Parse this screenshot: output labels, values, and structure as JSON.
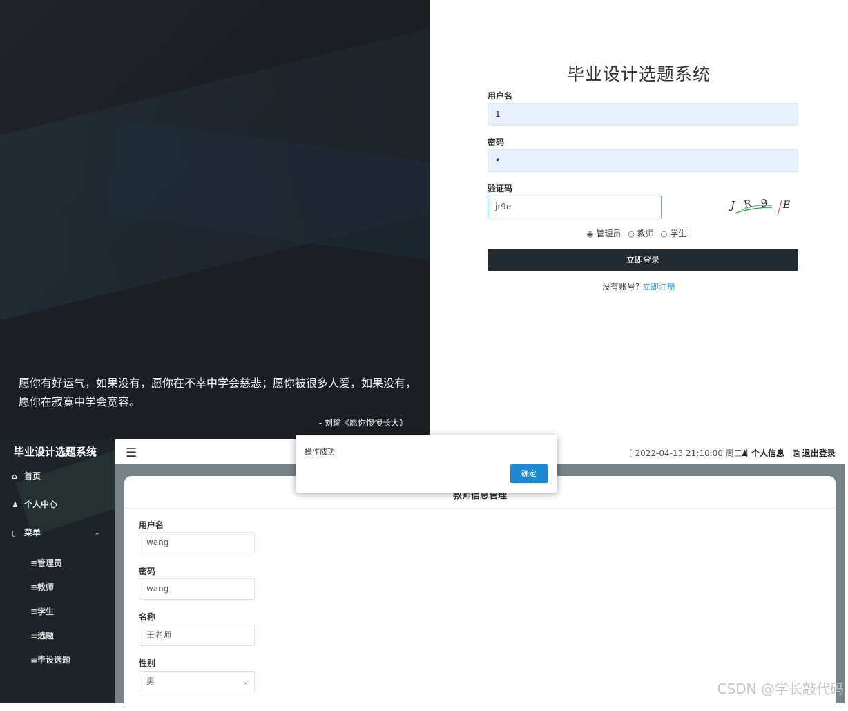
{
  "login": {
    "quote": "愿你有好运气，如果没有，愿你在不幸中学会慈悲；愿你被很多人爱，如果没有，愿你在寂寞中学会宽容。",
    "quote_source": "- 刘瑜《愿你慢慢长大》",
    "title": "毕业设计选题系统",
    "username_label": "用户名",
    "username_value": "1",
    "password_label": "密码",
    "password_value": "•",
    "captcha_label": "验证码",
    "captcha_value": "jr9e",
    "captcha_image_text": "J R 9 E",
    "roles": [
      "管理员",
      "教师",
      "学生"
    ],
    "selected_role": "管理员",
    "login_button": "立即登录",
    "no_account": "没有账号?",
    "register_link": "立即注册"
  },
  "admin": {
    "brand": "毕业设计选题系统",
    "nav": [
      {
        "label": "首页",
        "icon": "home-icon"
      },
      {
        "label": "个人中心",
        "icon": "user-icon"
      },
      {
        "label": "菜单",
        "icon": "file-icon"
      }
    ],
    "sub_menu": [
      "≡管理员",
      "≡教师",
      "≡学生",
      "≡选题",
      "≡毕设选题"
    ],
    "datetime": "[ 2022-04-13 21:10:00 周三 ]",
    "profile_link": "个人信息",
    "logout_link": "退出登录",
    "page_title": "教师信息管理",
    "form": {
      "username_label": "用户名",
      "username_value": "wang",
      "password_label": "密码",
      "password_value": "wang",
      "name_label": "名称",
      "name_value": "王老师",
      "gender_label": "性别",
      "gender_value": "男"
    }
  },
  "dialog": {
    "message": "操作成功",
    "confirm": "确定"
  },
  "watermark": "CSDN @学长敲代码",
  "colors": {
    "dark_bg": "#1b1f24",
    "button_dark": "#212a30",
    "input_bg": "#e8f0fe",
    "link": "#2aaee3",
    "dialog_button": "#1e88d4",
    "content_bg": "#788287"
  }
}
